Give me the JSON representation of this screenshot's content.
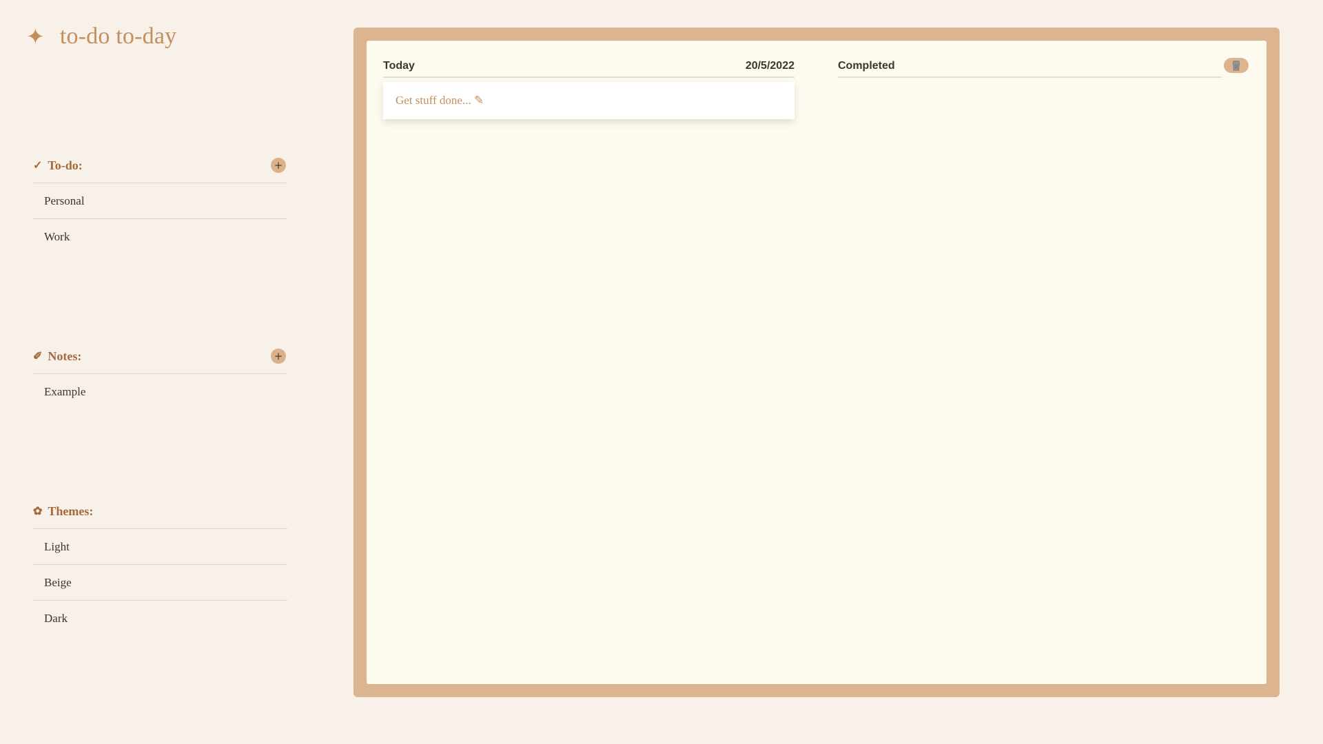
{
  "app": {
    "title": "to-do to-day",
    "logo_icon": "✦"
  },
  "sidebar": {
    "todo": {
      "title": "To-do:",
      "icon": "✓",
      "add_label": "+",
      "items": [
        {
          "label": "Personal"
        },
        {
          "label": "Work"
        }
      ]
    },
    "notes": {
      "title": "Notes:",
      "icon": "✐",
      "add_label": "+",
      "items": [
        {
          "label": "Example"
        }
      ]
    },
    "themes": {
      "title": "Themes:",
      "icon": "✿",
      "items": [
        {
          "label": "Light"
        },
        {
          "label": "Beige"
        },
        {
          "label": "Dark"
        }
      ]
    }
  },
  "board": {
    "today": {
      "title": "Today",
      "date": "20/5/2022"
    },
    "completed": {
      "title": "Completed"
    },
    "new_task": {
      "placeholder": "Get stuff done... ✎"
    },
    "trash_icon": "trash-icon"
  },
  "colors": {
    "background": "#f7f1e9",
    "accent": "#c48f5d",
    "frame": "#dcb590",
    "board": "#fdfbf0"
  }
}
